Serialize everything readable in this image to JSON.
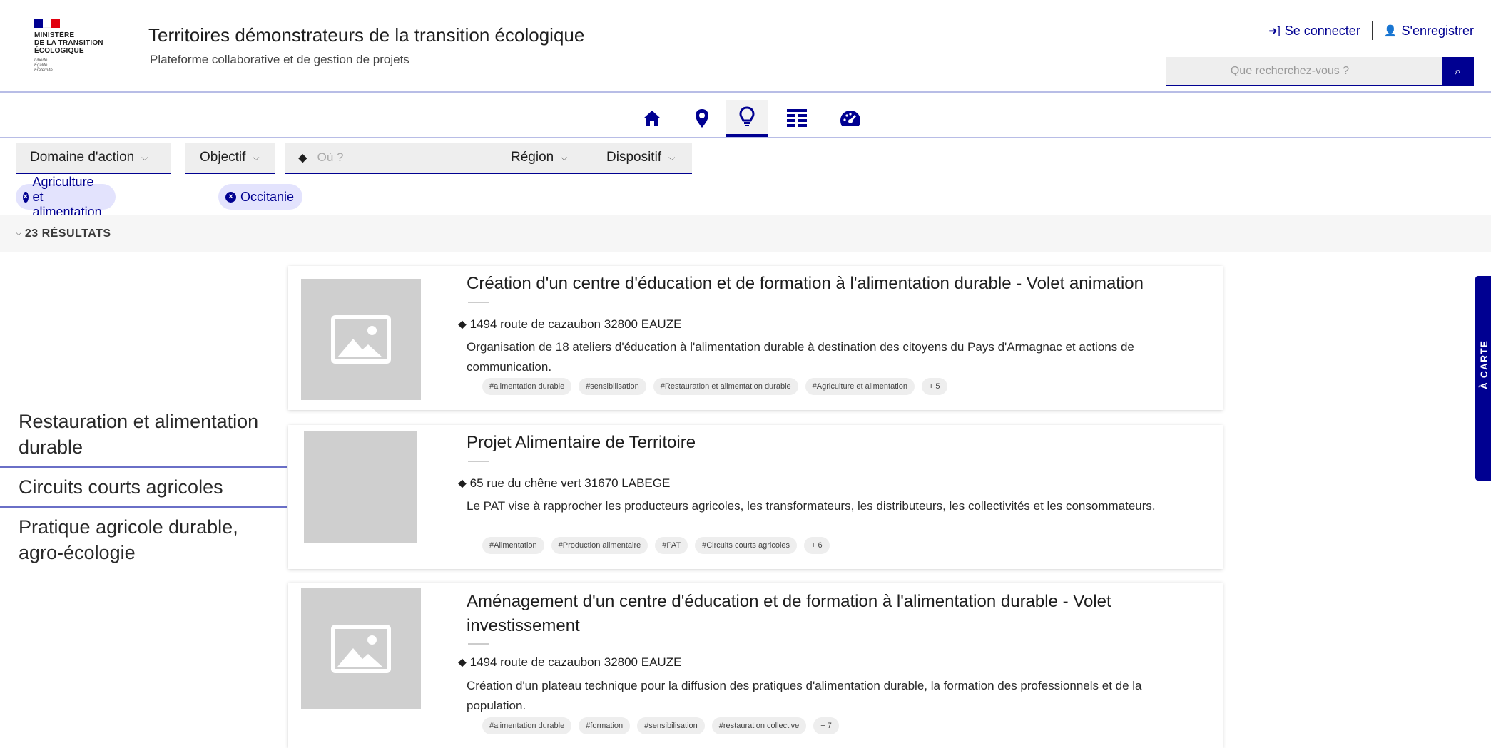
{
  "header": {
    "logo": {
      "ministry_lines": [
        "MINISTÈRE",
        "DE LA TRANSITION",
        "ÉCOLOGIQUE"
      ],
      "motto_lines": [
        "Liberté",
        "Égalité",
        "Fraternité"
      ],
      "flag_colors": [
        "#000091",
        "#ffffff",
        "#e1000f"
      ]
    },
    "title": "Territoires démonstrateurs de la transition écologique",
    "subtitle": "Plateforme collaborative et de gestion de projets",
    "login_label": "Se connecter",
    "register_label": "S'enregistrer",
    "search_placeholder": "Que recherchez-vous ?"
  },
  "nav": {
    "tabs": [
      {
        "icon": "home-icon",
        "active": false
      },
      {
        "icon": "map-marker-icon",
        "active": false
      },
      {
        "icon": "lightbulb-icon",
        "active": true
      },
      {
        "icon": "list-grid-icon",
        "active": false
      },
      {
        "icon": "dashboard-icon",
        "active": false
      }
    ]
  },
  "filters": {
    "domaine": "Domaine d'action",
    "objectif": "Objectif",
    "where_placeholder": "Où ?",
    "region": "Région",
    "dispositif": "Dispositif"
  },
  "active_filters": [
    "Agriculture et alimentation",
    "Occitanie"
  ],
  "results_label": "23 RÉSULTATS",
  "sidebar": {
    "items": [
      "Restauration et alimentation durable",
      "Circuits courts agricoles",
      "Pratique agricole durable, agro-écologie"
    ]
  },
  "projects": [
    {
      "title": "Création d'un centre d'éducation et de formation à l'alimentation durable - Volet animation",
      "address": "1494 route de cazaubon 32800 EAUZE",
      "description": "Organisation de 18 ateliers d'éducation à l'alimentation durable à destination des citoyens du Pays d'Armagnac et actions de communication.",
      "tags": [
        "#alimentation durable",
        "#sensibilisation",
        "#Restauration et alimentation durable",
        "#Agriculture et alimentation",
        "+ 5"
      ],
      "image": "placeholder"
    },
    {
      "title": "Projet Alimentaire de Territoire",
      "address": "65 rue du chêne vert 31670 LABEGE",
      "description": "Le PAT vise à rapprocher les producteurs agricoles, les transformateurs, les distributeurs, les collectivités et les consommateurs.",
      "tags": [
        "#Alimentation",
        "#Production alimentaire",
        "#PAT",
        "#Circuits courts agricoles",
        "+ 6"
      ],
      "image": "photo"
    },
    {
      "title": "Aménagement d'un centre d'éducation et de formation à l'alimentation durable - Volet investissement",
      "address": "1494 route de cazaubon 32800 EAUZE",
      "description": "Création d'un plateau technique pour la diffusion des pratiques d'alimentation durable, la formation des professionnels et de la population.",
      "tags": [
        "#alimentation durable",
        "#formation",
        "#sensibilisation",
        "#restauration collective",
        "+ 7"
      ],
      "image": "placeholder"
    }
  ],
  "map_tab_label": "À CARTE",
  "colors": {
    "primary": "#000091",
    "chip_bg": "#e3e3fd",
    "field_bg": "#eeeeee"
  }
}
